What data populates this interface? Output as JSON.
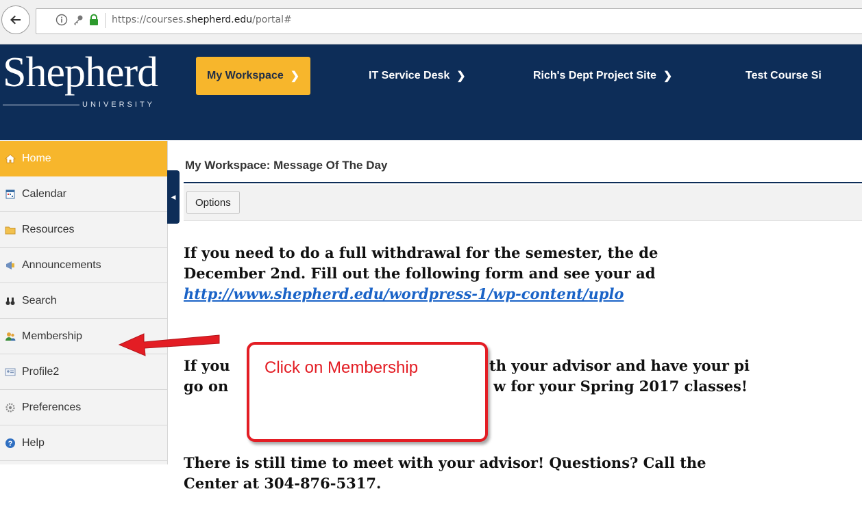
{
  "browser": {
    "url_prefix": "https://courses.",
    "url_domain": "shepherd.edu",
    "url_suffix": "/portal#"
  },
  "logo": {
    "name": "Shepherd",
    "subtitle": "UNIVERSITY"
  },
  "site_tabs": [
    {
      "label": "My Workspace",
      "active": true
    },
    {
      "label": "IT Service Desk",
      "active": false
    },
    {
      "label": "Rich's Dept Project Site",
      "active": false
    },
    {
      "label": "Test Course Si",
      "active": false
    }
  ],
  "nav": {
    "items": [
      {
        "label": "Home",
        "icon": "home-icon",
        "active": true
      },
      {
        "label": "Calendar",
        "icon": "calendar-icon",
        "active": false
      },
      {
        "label": "Resources",
        "icon": "folder-icon",
        "active": false
      },
      {
        "label": "Announcements",
        "icon": "megaphone-icon",
        "active": false
      },
      {
        "label": "Search",
        "icon": "binoculars-icon",
        "active": false
      },
      {
        "label": "Membership",
        "icon": "people-icon",
        "active": false
      },
      {
        "label": "Profile2",
        "icon": "profile-card-icon",
        "active": false
      },
      {
        "label": "Preferences",
        "icon": "gear-icon",
        "active": false
      },
      {
        "label": "Help",
        "icon": "help-icon",
        "active": false
      }
    ]
  },
  "main": {
    "title": "My Workspace: Message Of The Day",
    "options_label": "Options",
    "messages": {
      "p1_line1": "If you need to do a full withdrawal for the semester, the de",
      "p1_line2": "December 2nd.  Fill out the following form and see your ad",
      "p1_link": "http://www.shepherd.edu/wordpress-1/wp-content/uplo",
      "p2_line1_a": "If you",
      "p2_line1_b": "th your advisor and have your pi",
      "p2_line2_a": "go on",
      "p2_line2_b": "w for your Spring 2017 classes!",
      "p3_line1": "There is still time to meet with your advisor!  Questions?  Call the",
      "p3_line2": "Center at 304-876-5317."
    }
  },
  "annotation": {
    "text": "Click on Membership",
    "color": "#e31d24"
  },
  "colors": {
    "header_bg": "#0d2d58",
    "accent": "#f7b62c",
    "link": "#1a63c7"
  }
}
